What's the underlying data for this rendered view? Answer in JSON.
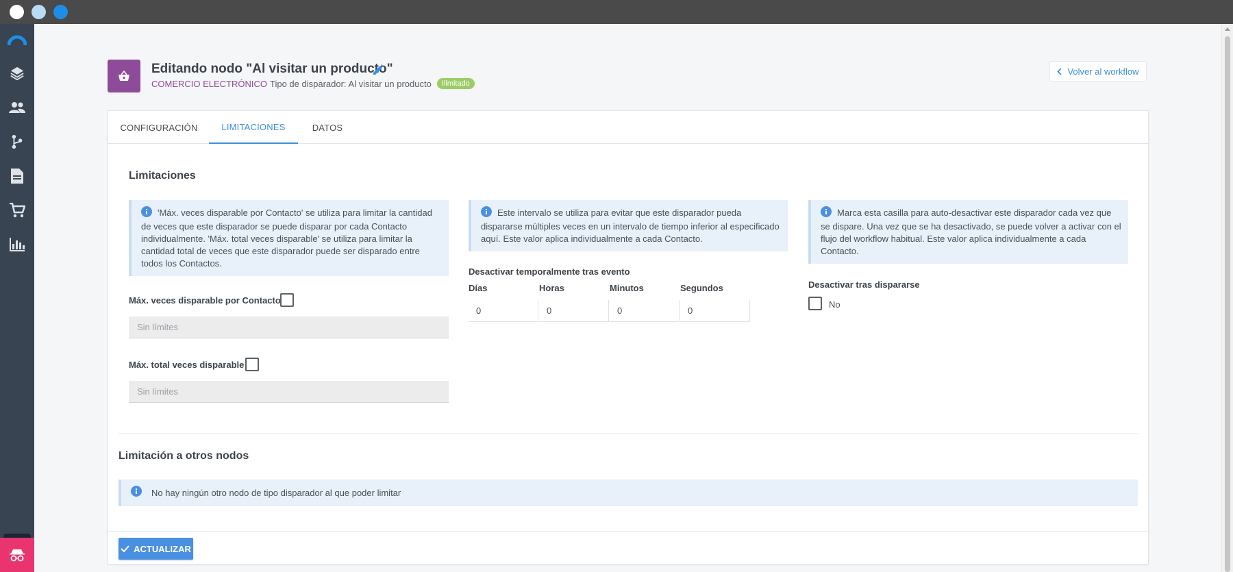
{
  "header": {
    "title": "Editando nodo \"Al visitar un producto\"",
    "category": "COMERCIO ELECTRÓNICO",
    "trigger_type": "Tipo de disparador: Al visitar un producto",
    "badge": "Ilimitado",
    "back_label": "Volver al workflow"
  },
  "tabs": [
    {
      "label": "CONFIGURACIÓN",
      "active": false
    },
    {
      "label": "LIMITACIONES",
      "active": true
    },
    {
      "label": "DATOS",
      "active": false
    }
  ],
  "limitaciones": {
    "title": "Limitaciones",
    "col1": {
      "info": "'Máx. veces disparable por Contacto' se utiliza para limitar la cantidad de veces que este disparador se puede disparar por cada Contacto individualmente. 'Máx. total veces disparable' se utiliza para limitar la cantidad total de veces que este disparador puede ser disparado entre todos los Contactos.",
      "max_per_contact_label": "Máx. veces disparable por Contacto",
      "max_per_contact_placeholder": "Sin límites",
      "max_total_label": "Máx. total veces disparable",
      "max_total_placeholder": "Sin límites"
    },
    "col2": {
      "info": "Este intervalo se utiliza para evitar que este disparador pueda dispararse múltiples veces en un intervalo de tiempo inferior al especificado aquí. Este valor aplica individualmente a cada Contacto.",
      "label": "Desactivar temporalmente tras evento",
      "fields": [
        {
          "label": "Días",
          "value": "0"
        },
        {
          "label": "Horas",
          "value": "0"
        },
        {
          "label": "Minutos",
          "value": "0"
        },
        {
          "label": "Segundos",
          "value": "0"
        }
      ]
    },
    "col3": {
      "info": "Marca esta casilla para auto-desactivar este disparador cada vez que se dispare. Una vez que se ha desactivado, se puede volver a activar con el flujo del workflow habitual. Este valor aplica individualmente a cada Contacto.",
      "label": "Desactivar tras dispararse",
      "checkbox_label": "No"
    }
  },
  "otros_nodos": {
    "title": "Limitación a otros nodos",
    "info": "No hay ningún otro nodo de tipo disparador al que poder limitar"
  },
  "update_label": "ACTUALIZAR",
  "colors": {
    "accent": "#3d8fe0",
    "brand_purple": "#8e4b9a",
    "sidebar": "#384452",
    "badge_green": "#9ccc65",
    "footer_pink": "#e93470"
  }
}
